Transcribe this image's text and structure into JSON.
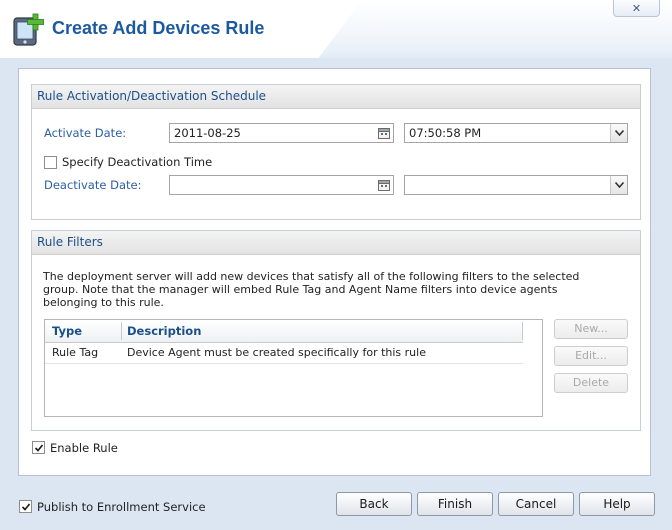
{
  "window": {
    "title": "Create Add Devices Rule",
    "close_label": "✕"
  },
  "schedule": {
    "header": "Rule Activation/Deactivation Schedule",
    "activate_label": "Activate Date:",
    "activate_date": "2011-08-25",
    "activate_time": "07:50:58 PM",
    "specify_deactivation_label": "Specify Deactivation Time",
    "specify_deactivation_checked": false,
    "deactivate_label": "Deactivate Date:",
    "deactivate_date": "",
    "deactivate_time": ""
  },
  "filters": {
    "header": "Rule Filters",
    "description": "The deployment server will add new devices that satisfy all of the following filters to the selected group. Note that the manager will embed Rule Tag and Agent Name filters into device agents belonging to this rule.",
    "columns": [
      "Type",
      "Description"
    ],
    "rows": [
      {
        "type": "Rule Tag",
        "description": "Device Agent must be created specifically for this rule"
      }
    ],
    "new_label": "New...",
    "edit_label": "Edit...",
    "delete_label": "Delete"
  },
  "enable_rule": {
    "label": "Enable Rule",
    "checked": true
  },
  "publish": {
    "label": "Publish to Enrollment Service",
    "checked": true
  },
  "footer": {
    "back": "Back",
    "finish": "Finish",
    "cancel": "Cancel",
    "help": "Help"
  },
  "colors": {
    "accent": "#1c5aa0",
    "label": "#2c5ea3",
    "background": "#dce6f2"
  }
}
